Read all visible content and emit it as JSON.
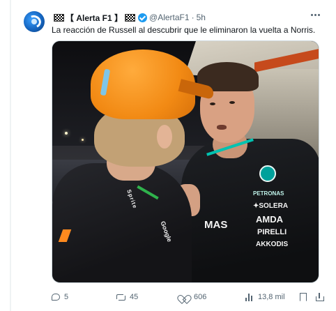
{
  "tweet": {
    "display_name": "【 Alerta F1 】",
    "handle": "@AlertaF1",
    "separator": "·",
    "time": "5h",
    "text": "La reacción de Russell al descubrir que le eliminaron la vuelta a Norris.",
    "verified": true
  },
  "media": {
    "sponsors": {
      "petronas": "PETRONAS",
      "solera": "✦SOLERA",
      "amd": "AMDA",
      "pirelli": "PIRELLI",
      "akkodis": "AKKODIS",
      "mas": "MAS",
      "norris_logo": "Sprite",
      "norris_logo2": "Google"
    }
  },
  "actions": {
    "replies": "5",
    "retweets": "45",
    "likes": "606",
    "views": "13,8 mil"
  },
  "colors": {
    "accent": "#1d9bf0",
    "text": "#0f1419",
    "muted": "#536471",
    "mclaren_orange": "#f28a14",
    "mercedes_teal": "#00a19b"
  },
  "icons": [
    "checkered-flag-icon",
    "verified-icon",
    "more-icon",
    "reply-icon",
    "retweet-icon",
    "like-icon",
    "views-icon",
    "bookmark-icon",
    "share-icon"
  ]
}
